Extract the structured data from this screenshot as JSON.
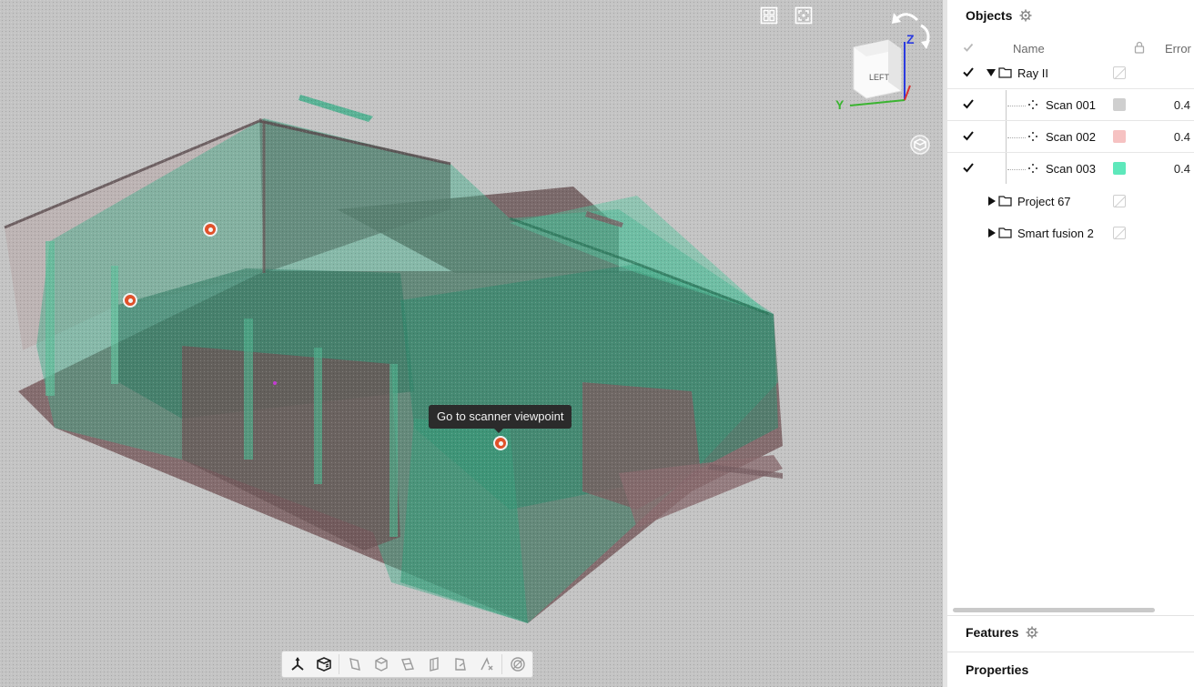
{
  "viewport": {
    "tooltip": "Go to scanner viewpoint",
    "top_buttons": [
      {
        "name": "split-view-icon"
      },
      {
        "name": "fit-view-icon"
      }
    ],
    "viewcube": {
      "face_label": "LEFT",
      "axis_z": "Z",
      "axis_y": "Y",
      "axis_colors": {
        "z": "#2a3ae0",
        "y": "#3bb431",
        "x": "#d93030"
      }
    },
    "markers_count": 3,
    "toolbar_icons": [
      "move-gizmo-icon",
      "box-view-icon",
      "cut-plane-icon",
      "clip-box-icon",
      "section-icon",
      "slice-icon",
      "measure-icon",
      "distance-icon",
      "ring-icon"
    ]
  },
  "objects_panel": {
    "title": "Objects",
    "columns": {
      "name": "Name",
      "error": "Error"
    },
    "rows": [
      {
        "label": "Ray II",
        "type": "folder",
        "expanded": true,
        "checked": true,
        "error": ""
      },
      {
        "label": "Scan 001",
        "type": "scan",
        "checked": true,
        "color": "#cfcfcf",
        "error": "0.4"
      },
      {
        "label": "Scan 002",
        "type": "scan",
        "checked": true,
        "color": "#f6c2c2",
        "error": "0.4"
      },
      {
        "label": "Scan 003",
        "type": "scan",
        "checked": true,
        "color": "#5ee8bb",
        "error": "0.4"
      },
      {
        "label": "Project 67",
        "type": "folder",
        "expanded": false,
        "checked": false,
        "error": ""
      },
      {
        "label": "Smart fusion 2",
        "type": "folder",
        "expanded": false,
        "checked": false,
        "error": ""
      }
    ]
  },
  "features_panel": {
    "title": "Features"
  },
  "properties_panel": {
    "title": "Properties"
  }
}
